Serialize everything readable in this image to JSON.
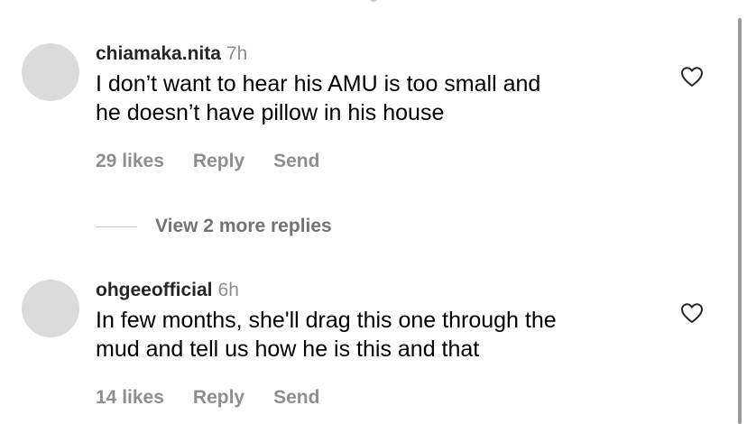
{
  "comments": [
    {
      "username": "chiamaka.nita",
      "time": "7h",
      "text_line1": "I don’t want to hear his AMU is too small and",
      "text_line2": "he doesn’t have pillow in his house",
      "likes": "29 likes",
      "reply_label": "Reply",
      "send_label": "Send"
    },
    {
      "username": "ohgeeofficial",
      "time": "6h",
      "text_line1": "In few months, she'll drag this one through the",
      "text_line2": "mud and tell us how he is this and that",
      "likes": "14 likes",
      "reply_label": "Reply",
      "send_label": "Send"
    }
  ],
  "view_more_replies": "View 2 more replies",
  "icons": {
    "like": "heart-icon",
    "avatar": "avatar-placeholder"
  },
  "colors": {
    "secondary_text": "#8e8e8e",
    "avatar": "#dbdbdb"
  }
}
